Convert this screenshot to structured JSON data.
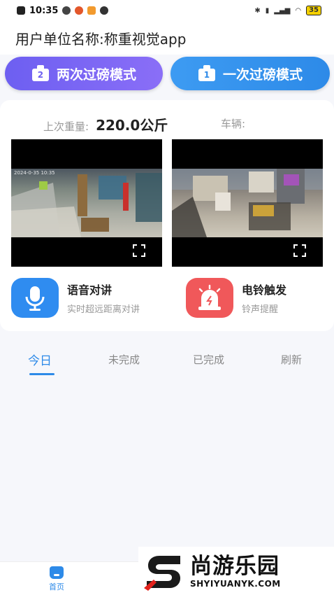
{
  "status_bar": {
    "time": "10:35",
    "battery": "35"
  },
  "header": {
    "unit_name": "用户单位名称:称重视觉app"
  },
  "modes": {
    "two_weigh": {
      "label": "两次过磅模式",
      "badge": "2"
    },
    "one_weigh": {
      "label": "一次过磅模式",
      "badge": "1"
    }
  },
  "weight_info": {
    "last_weight_label": "上次重量:",
    "last_weight_value": "220.0公斤",
    "vehicle_label": "车辆:"
  },
  "cameras": [
    {
      "timestamp": "2024-0-35 10:35"
    },
    {
      "timestamp": ""
    }
  ],
  "features": {
    "voice": {
      "title": "语音对讲",
      "subtitle": "实时超远距离对讲"
    },
    "bell": {
      "title": "电铃触发",
      "subtitle": "铃声提醒"
    }
  },
  "tabs": [
    {
      "label": "今日",
      "active": true
    },
    {
      "label": "未完成",
      "active": false
    },
    {
      "label": "已完成",
      "active": false
    },
    {
      "label": "刷新",
      "active": false
    }
  ],
  "bottom_nav": {
    "home_label": "首页"
  },
  "watermark": {
    "cn": "尚游乐园",
    "en": "SHYIYUANYK.COM"
  },
  "colors": {
    "primary_blue": "#2d8ae8",
    "purple": "#6d5ff1",
    "alert_red": "#f0585a"
  }
}
